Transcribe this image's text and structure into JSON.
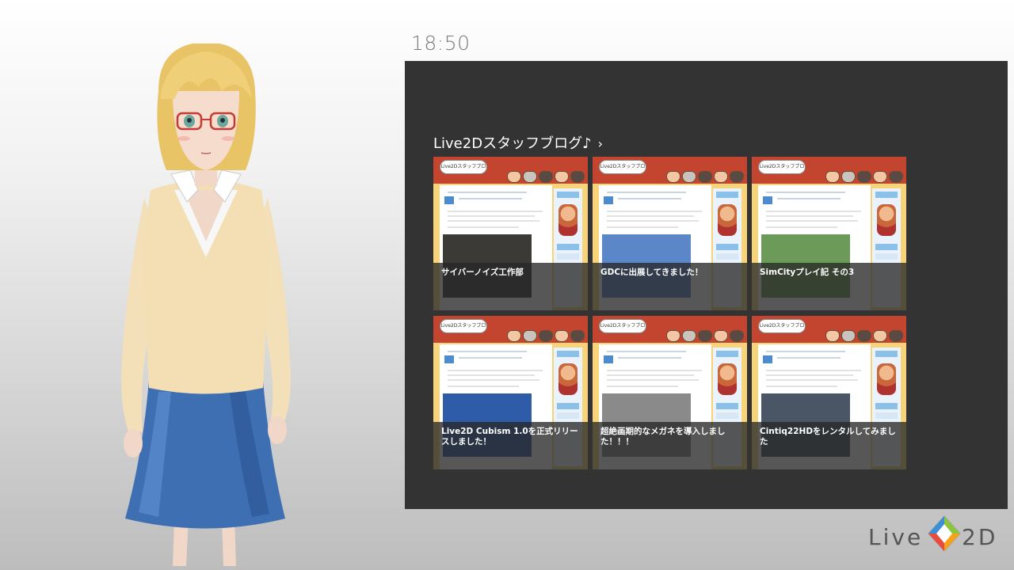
{
  "clock": "18:50",
  "section": {
    "title": "Live2Dスタッフブログ♪",
    "chevron": "›"
  },
  "tiles": [
    {
      "caption": "サイバーノイズ工作部",
      "bubble": "Live2Dスタッフブログ♪",
      "photo_color": "#3b3a36"
    },
    {
      "caption": "GDCに出展してきました！",
      "bubble": "Live2Dスタッフブログ♪",
      "photo_color": "#5b86c8"
    },
    {
      "caption": "SimCityプレイ記 その3",
      "bubble": "Live2Dスタッフブログ♪",
      "photo_color": "#6c9a58"
    },
    {
      "caption": "Live2D Cubism 1.0を正式リリースしました！",
      "bubble": "Live2Dスタッフブログ♪",
      "photo_color": "#2f5ca8"
    },
    {
      "caption": "超絶画期的なメガネを導入しました！！！",
      "bubble": "Live2Dスタッフブログ♪",
      "photo_color": "#8a8a8a"
    },
    {
      "caption": "Cintiq22HDをレンタルしてみました",
      "bubble": "Live2Dスタッフブログ♪",
      "photo_color": "#4a5666"
    }
  ],
  "logo": {
    "left": "Live",
    "right": "2D"
  },
  "colors": {
    "panel": "#333333",
    "blog_header": "#c4452f",
    "clock": "#7a7a7a"
  }
}
